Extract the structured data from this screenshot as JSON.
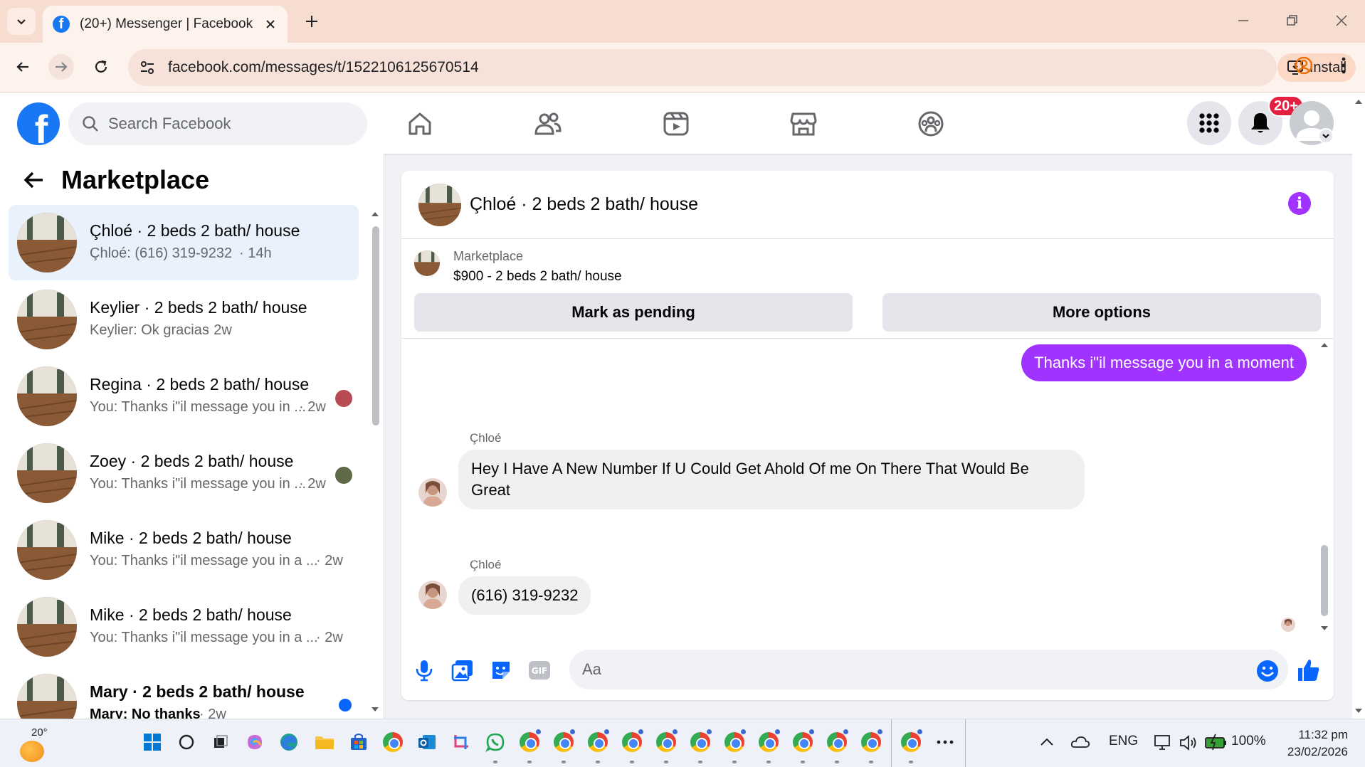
{
  "browser": {
    "tab_title": "(20+) Messenger | Facebook",
    "url": "facebook.com/messages/t/1522106125670514",
    "install_label": "Install"
  },
  "header": {
    "search_placeholder": "Search Facebook",
    "notification_badge": "20+",
    "brand_color": "#1877f2"
  },
  "sidebar": {
    "title": "Marketplace",
    "conversations": [
      {
        "name": "Çhloé · 2 beds 2 bath/ house",
        "preview": "Çhloé: (616) 319-9232",
        "time": "· 14h",
        "active": true
      },
      {
        "name": "Keylier · 2 beds 2 bath/ house",
        "preview": "Keylier: Ok gracias",
        "time": "· 2w"
      },
      {
        "name": "Regina · 2 beds 2 bath/ house",
        "preview": "You: Thanks i\"il message you in ...",
        "time": "· 2w"
      },
      {
        "name": "Zoey · 2 beds 2 bath/ house",
        "preview": "You: Thanks i\"il message you in ...",
        "time": "· 2w"
      },
      {
        "name": "Mike · 2 beds 2 bath/ house",
        "preview": "You: Thanks i\"il message you in a ...",
        "time": "· 2w"
      },
      {
        "name": "Mike · 2 beds 2 bath/ house",
        "preview": "You: Thanks i\"il message you in a ...",
        "time": "· 2w"
      },
      {
        "name": "Mary · 2 beds 2 bath/ house",
        "preview": "Mary: No thanks",
        "time": "· 2w",
        "unread": true
      }
    ]
  },
  "chat": {
    "title": "Çhloé · 2 beds 2 bath/ house",
    "listing_label": "Marketplace",
    "listing_price": "$900 - 2 beds 2 bath/ house",
    "mark_pending": "Mark as pending",
    "more_options": "More options",
    "messages": {
      "outgoing": "Thanks i\"il message you in a moment",
      "sender1": "Çhloé",
      "incoming1": "Hey I Have A New Number If U Could Get Ahold Of me On There That Would Be Great",
      "sender2": "Çhloé",
      "incoming2": "(616) 319-9232"
    },
    "composer_placeholder": "Aa",
    "accent_color": "#a033ff"
  },
  "taskbar": {
    "temperature": "20°",
    "language": "ENG",
    "battery": "100%",
    "time": "11:32 pm",
    "date": "23/02/2026"
  }
}
